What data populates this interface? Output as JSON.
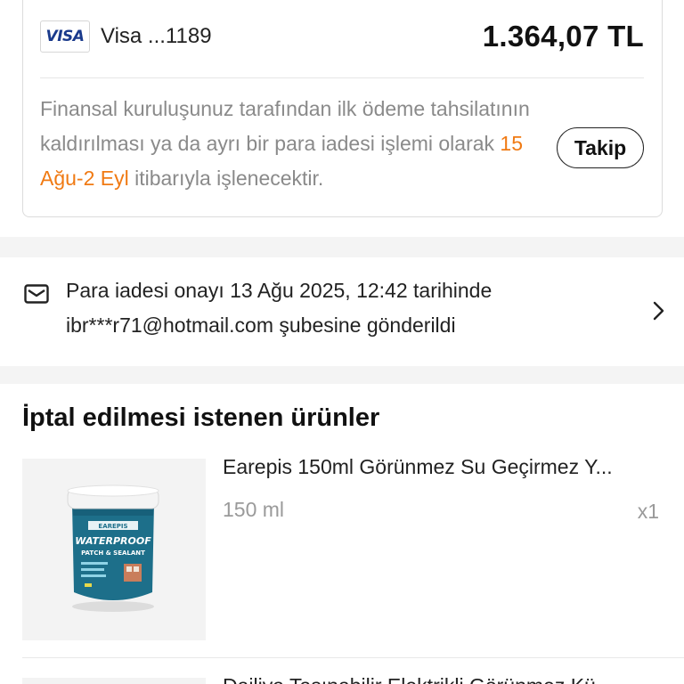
{
  "payment": {
    "card_brand": "VISA",
    "card_label": "Visa ...1189",
    "amount": "1.364,07 TL"
  },
  "refund_note": {
    "text_before": "Finansal kuruluşunuz tarafından ilk ödeme tahsilatının kaldırılması ya da ayrı bir para iadesi işlemi olarak ",
    "date_range": "15 Ağu-2 Eyl",
    "text_after": " itibarıyla işlenecektir.",
    "highlight_color": "#f07a13"
  },
  "follow_button": {
    "label": "Takip"
  },
  "email_notice": {
    "icon": "mail-icon",
    "text": "Para iadesi onayı 13 Ağu 2025, 12:42 tarihinde ibr***r71@hotmail.com şubesine gönderildi"
  },
  "items": {
    "title": "İptal edilmesi istenen ürünler",
    "list": [
      {
        "name": "Earepis 150ml Görünmez Su Geçirmez Y...",
        "variant": "150 ml",
        "quantity": "x1",
        "image_text": {
          "brand": "EAREPIS",
          "line1": "WATERPROOF",
          "line2": "PATCH & SEALANT"
        }
      },
      {
        "name": "Dailiya Taşınabilir Elektrikli Görünmez Kü"
      }
    ]
  }
}
